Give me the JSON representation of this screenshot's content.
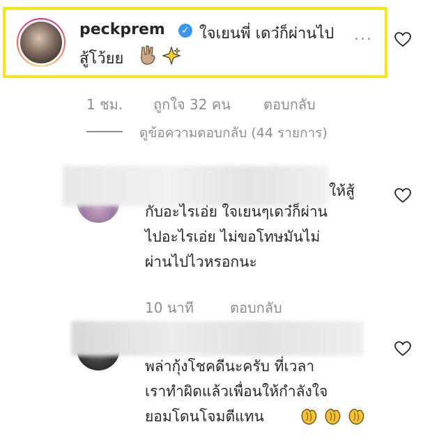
{
  "comments": [
    {
      "username": "peckprem",
      "verified_icon": "verified-badge-icon",
      "text_line1": "ใจเยนพี่ เดว๋ก็ผ่านไป",
      "more": "...",
      "text_line2": "สู้โว้ยย",
      "emojis": [
        "hand-emoji-icon",
        "sparkle-emoji-icon"
      ],
      "time": "1 ชม.",
      "likes": "ถูกใจ 32 คน",
      "reply": "ตอบกลับ",
      "view_replies": "ดูข้อความตอบกลับ (44 รายการ)"
    },
    {
      "text_line1": "ให้สู้",
      "text_line2": "กับอะไรเอ่ย ใจเยนๆเดว๋ก็ผ่าน",
      "text_line3": "ไปอะไรเอ่ย ไม่ขอโทษมันไม่",
      "text_line4": "ผ่านไปไวหรอกนะ",
      "time": "10 นาที",
      "reply": "ตอบกลับ"
    },
    {
      "text_line1": "พล่ากุ้งโชคดีนะครับ ที่เวลา",
      "text_line2": "เราทำผิดแล้วเพื่อนให้กำลังใจ",
      "text_line3": "ยอมโดนโจมตีแทน",
      "emojis": [
        "clapping-hands-icon",
        "clapping-hands-icon",
        "clapping-hands-icon"
      ]
    }
  ],
  "colors": {
    "highlight": "#f5e614",
    "verified": "#3897f0",
    "meta_text": "#8e8e8e",
    "body_text": "#262626"
  }
}
